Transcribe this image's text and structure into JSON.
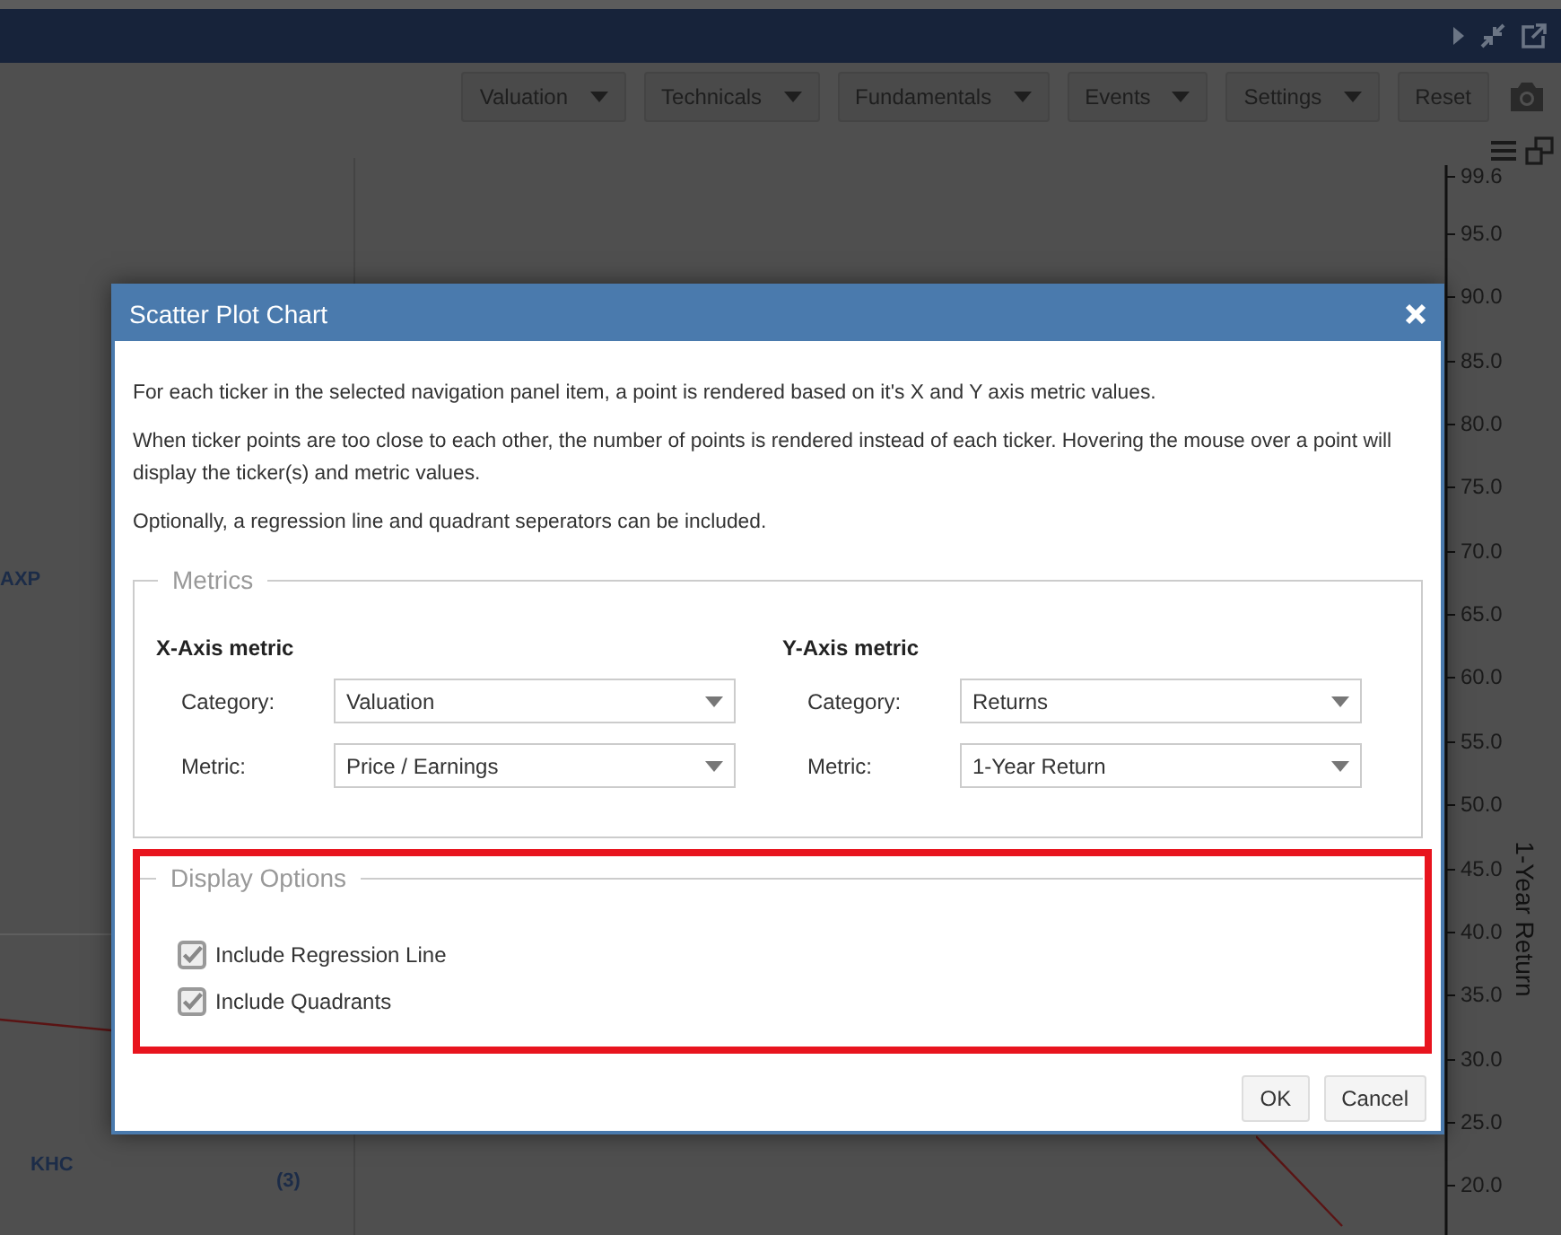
{
  "toolbar": [
    {
      "label": "Valuation",
      "kind": "dropdown"
    },
    {
      "label": "Technicals",
      "kind": "dropdown"
    },
    {
      "label": "Fundamentals",
      "kind": "dropdown"
    },
    {
      "label": "Events",
      "kind": "dropdown"
    },
    {
      "label": "Settings",
      "kind": "dropdown"
    },
    {
      "label": "Reset",
      "kind": "button"
    }
  ],
  "chart": {
    "point_labels": [
      {
        "label": "AXP"
      },
      {
        "label": "KHC"
      },
      {
        "label": "(3)"
      }
    ],
    "y_axis": {
      "title": "1-Year Return",
      "ticks": [
        "99.6",
        "95.0",
        "90.0",
        "85.0",
        "80.0",
        "75.0",
        "70.0",
        "65.0",
        "60.0",
        "55.0",
        "50.0",
        "45.0",
        "40.0",
        "35.0",
        "30.0",
        "25.0",
        "20.0"
      ]
    }
  },
  "dialog": {
    "title": "Scatter Plot Chart",
    "paragraphs": [
      "For each ticker in the selected navigation panel item, a point is rendered based on it's X and Y axis metric values.",
      "When ticker points are too close to each other, the number of points is rendered instead of each ticker. Hovering the mouse over a point will display the ticker(s) and metric values.",
      "Optionally, a regression line and quadrant seperators can be included."
    ],
    "metrics": {
      "legend": "Metrics",
      "columns": [
        {
          "heading": "X-Axis metric",
          "fields": [
            {
              "label": "Category:",
              "value": "Valuation"
            },
            {
              "label": "Metric:",
              "value": "Price / Earnings"
            }
          ]
        },
        {
          "heading": "Y-Axis metric",
          "fields": [
            {
              "label": "Category:",
              "value": "Returns"
            },
            {
              "label": "Metric:",
              "value": "1-Year Return"
            }
          ]
        }
      ]
    },
    "display_options": {
      "legend": "Display Options",
      "highlighted": true,
      "options": [
        {
          "label": "Include Regression Line",
          "checked": true
        },
        {
          "label": "Include Quadrants",
          "checked": true
        }
      ]
    },
    "buttons": [
      {
        "label": "OK"
      },
      {
        "label": "Cancel"
      }
    ]
  }
}
